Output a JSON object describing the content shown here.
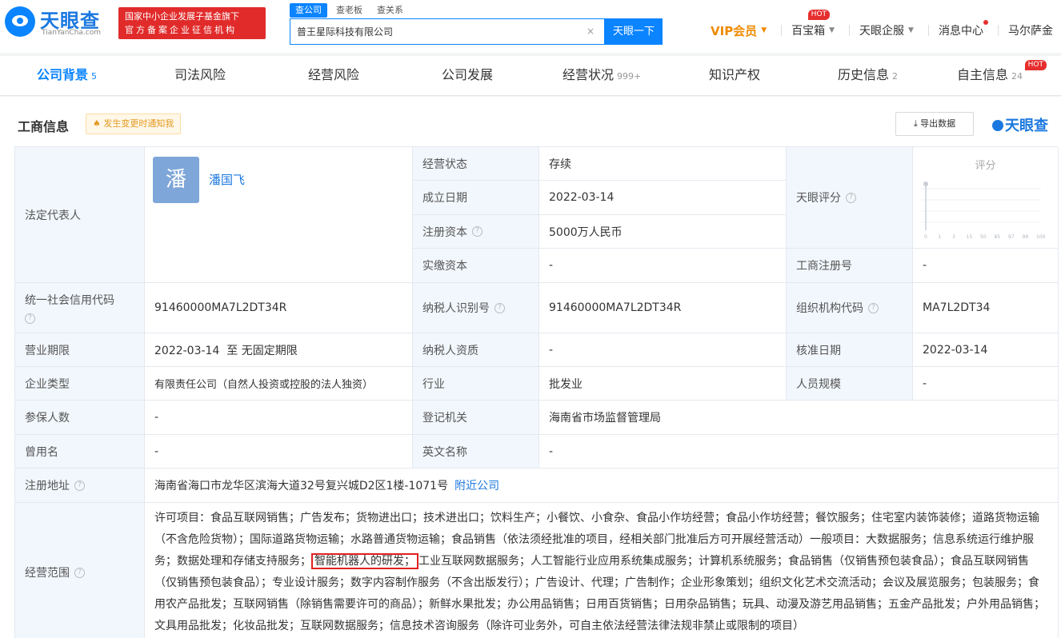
{
  "header": {
    "logo": {
      "name": "天眼查",
      "sub": "TianYanCha.com"
    },
    "fund_badge": {
      "line1": "国家中小企业发展子基金旗下",
      "line2": "官方备案企业征信机构"
    },
    "search": {
      "tabs": [
        "查公司",
        "查老板",
        "查关系"
      ],
      "value": "普王星际科技有限公司",
      "clear": "×",
      "button": "天眼一下"
    },
    "nav": {
      "vip": "VIP会员",
      "baibaoxiang": "百宝箱",
      "hot": "HOT",
      "qiye": "天眼企服",
      "messages": "消息中心",
      "user": "马尔萨金"
    }
  },
  "tabs": [
    {
      "label": "公司背景",
      "count": "5"
    },
    {
      "label": "司法风险",
      "count": ""
    },
    {
      "label": "经营风险",
      "count": ""
    },
    {
      "label": "公司发展",
      "count": ""
    },
    {
      "label": "经营状况",
      "count": "999+"
    },
    {
      "label": "知识产权",
      "count": ""
    },
    {
      "label": "历史信息",
      "count": "2"
    },
    {
      "label": "自主信息",
      "count": "24",
      "hot": "HOT"
    }
  ],
  "section": {
    "title": "工商信息",
    "notify": "发生变更时通知我",
    "export": "导出数据",
    "brand": "天眼查"
  },
  "info": {
    "legal_rep_label": "法定代表人",
    "legal_rep_avatar": "潘",
    "legal_rep_name": "潘国飞",
    "status_label": "经营状态",
    "status_value": "存续",
    "founded_label": "成立日期",
    "founded_value": "2022-03-14",
    "reg_capital_label": "注册资本",
    "reg_capital_value": "5000万人民币",
    "paid_capital_label": "实缴资本",
    "paid_capital_value": "-",
    "tianyan_score_label": "天眼评分",
    "score_title": "评分",
    "score_ticks": [
      "0",
      "1",
      "3",
      "15",
      "50",
      "85",
      "97",
      "99",
      "100"
    ],
    "biz_reg_no_label": "工商注册号",
    "biz_reg_no_value": "-",
    "credit_code_label": "统一社会信用代码",
    "credit_code_value": "91460000MA7L2DT34R",
    "taxpayer_id_label": "纳税人识别号",
    "taxpayer_id_value": "91460000MA7L2DT34R",
    "org_code_label": "组织机构代码",
    "org_code_value": "MA7L2DT34",
    "term_label": "营业期限",
    "term_value": "2022-03-14  至 无固定期限",
    "taxpayer_qual_label": "纳税人资质",
    "taxpayer_qual_value": "-",
    "approval_date_label": "核准日期",
    "approval_date_value": "2022-03-14",
    "company_type_label": "企业类型",
    "company_type_value": "有限责任公司（自然人投资或控股的法人独资）",
    "industry_label": "行业",
    "industry_value": "批发业",
    "staff_size_label": "人员规模",
    "staff_size_value": "-",
    "insured_label": "参保人数",
    "insured_value": "-",
    "reg_authority_label": "登记机关",
    "reg_authority_value": "海南省市场监督管理局",
    "former_name_label": "曾用名",
    "former_name_value": "-",
    "english_name_label": "英文名称",
    "english_name_value": "-",
    "address_label": "注册地址",
    "address_value": "海南省海口市龙华区滨海大道32号复兴城D2区1楼-1071号",
    "nearby_link": "附近公司",
    "scope_label": "经营范围",
    "scope_before": "许可项目：食品互联网销售；广告发布；货物进出口；技术进出口；饮料生产；小餐饮、小食杂、食品小作坊经营；食品小作坊经营；餐饮服务；住宅室内装饰装修；道路货物运输（不含危险货物）；国际道路货物运输；水路普通货物运输；食品销售（依法须经批准的项目，经相关部门批准后方可开展经营活动）一般项目：大数据服务；信息系统运行维护服务；数据处理和存储支持服务；",
    "scope_highlight": "智能机器人的研发；",
    "scope_after": "工业互联网数据服务；人工智能行业应用系统集成服务；计算机系统服务；食品销售（仅销售预包装食品）；食品互联网销售（仅销售预包装食品）；专业设计服务；数字内容制作服务（不含出版发行）；广告设计、代理；广告制作；企业形象策划；组织文化艺术交流活动；会议及展览服务；包装服务；食用农产品批发；互联网销售（除销售需要许可的商品）；新鲜水果批发；办公用品销售；日用百货销售；日用杂品销售；玩具、动漫及游艺用品销售；五金产品批发；户外用品销售；文具用品批发；化妆品批发；互联网数据服务；信息技术咨询服务（除许可业务外，可自主依法经营法律法规非禁止或限制的项目）"
  },
  "colors": {
    "accent": "#0a84ff",
    "label_bg": "#f2f7fd",
    "hot": "#e62e2e",
    "vip": "#f08a00"
  }
}
